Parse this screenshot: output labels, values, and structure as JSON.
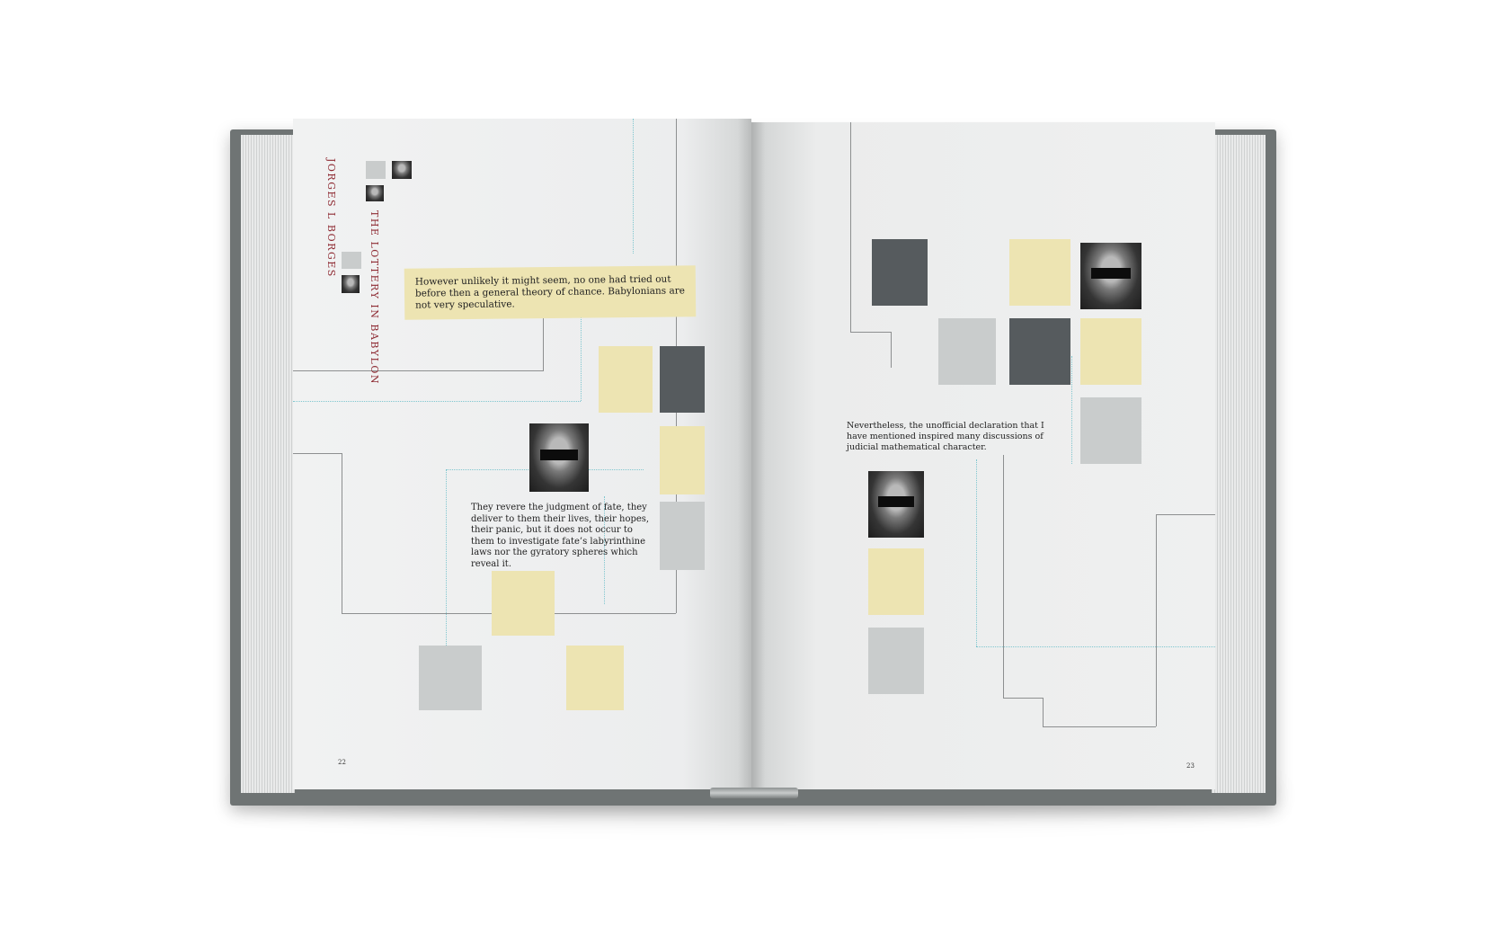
{
  "book": {
    "author": "JORGES L BORGES",
    "title": "THE LOTTERY IN BABYLON"
  },
  "left_page": {
    "quote": "However unlikely it might seem, no one had tried out before then a general theory of chance. Babylonians are not very speculative.",
    "paragraph": "They revere the judgment of fate, they deliver to them their lives, their hopes, their panic, but it does not occur to them to investigate fate’s labyrinthine laws nor the gyratory spheres which reveal it.",
    "page_number": "22"
  },
  "right_page": {
    "paragraph": "Nevertheless, the unofficial declaration that I have mentioned inspired many discussions of judicial mathematical character.",
    "page_number": "23"
  },
  "colors": {
    "yellow": "#ede4b2",
    "dark_grey": "#565b5e",
    "light_grey": "#c9cccc",
    "title_red": "#8e2b33",
    "guide_blue": "#7fc6cf",
    "cover": "#6f7474"
  }
}
